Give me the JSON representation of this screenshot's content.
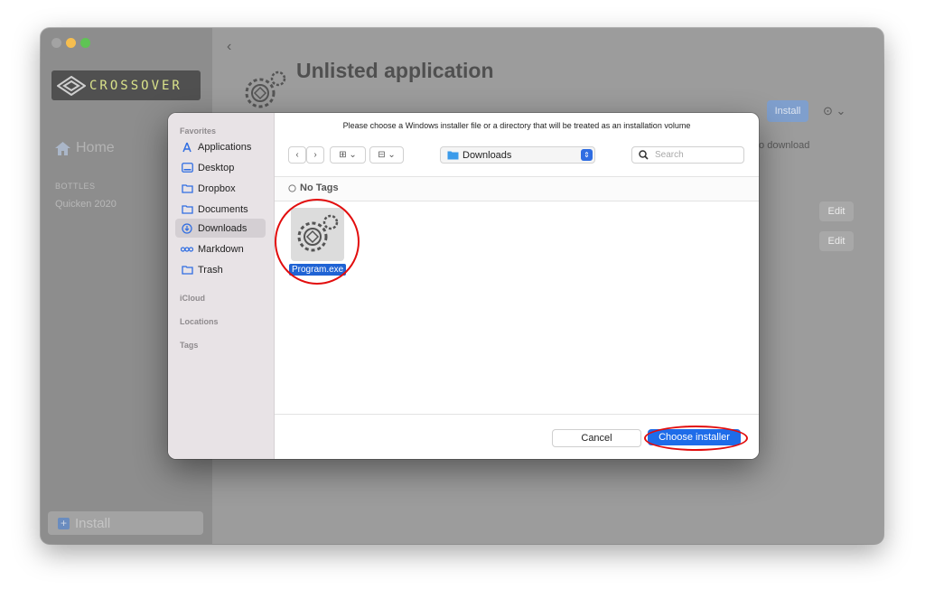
{
  "app": {
    "logo_text": "CROSSOVER",
    "home_label": "Home",
    "bottles_header": "BOTTLES",
    "bottles": [
      "Quicken 2020"
    ],
    "sidebar_install_label": "Install"
  },
  "main": {
    "back_glyph": "‹",
    "title": "Unlisted application",
    "install_label": "Install",
    "more_glyph": "⊙ ⌄",
    "download_text": "to download",
    "edit_labels": [
      "Edit",
      "Edit"
    ]
  },
  "dialog": {
    "prompt": "Please choose a Windows installer file or a directory that will be treated as an installation volume",
    "sidebar": {
      "favorites_header": "Favorites",
      "items": [
        {
          "label": "Applications",
          "icon": "applications-icon"
        },
        {
          "label": "Desktop",
          "icon": "desktop-icon"
        },
        {
          "label": "Dropbox",
          "icon": "folder-icon"
        },
        {
          "label": "Documents",
          "icon": "folder-icon"
        },
        {
          "label": "Downloads",
          "icon": "downloads-icon"
        },
        {
          "label": "Markdown",
          "icon": "markdown-icon"
        },
        {
          "label": "Trash",
          "icon": "folder-icon"
        }
      ],
      "icloud_header": "iCloud",
      "locations_header": "Locations",
      "tags_header": "Tags"
    },
    "toolbar": {
      "back_glyph": "‹",
      "forward_glyph": "›",
      "grid_view_glyph": "⊞ ⌄",
      "group_glyph": "⊟ ⌄",
      "location": "Downloads",
      "search_placeholder": "Search"
    },
    "tags_label": "No Tags",
    "file": {
      "name": "Program.exe"
    },
    "cancel_label": "Cancel",
    "choose_label": "Choose installer"
  },
  "colors": {
    "accent_blue": "#1e6ce9",
    "annotation_red": "#e20d0d",
    "traffic_yellow": "#f6be4f",
    "traffic_green": "#5fc454"
  }
}
